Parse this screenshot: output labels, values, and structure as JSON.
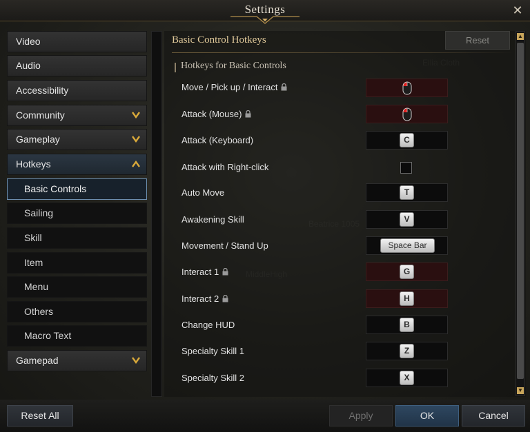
{
  "window": {
    "title": "Settings"
  },
  "nav": {
    "items": [
      {
        "label": "Video"
      },
      {
        "label": "Audio"
      },
      {
        "label": "Accessibility"
      },
      {
        "label": "Community"
      },
      {
        "label": "Gameplay"
      },
      {
        "label": "Hotkeys"
      },
      {
        "label": "Basic Controls"
      },
      {
        "label": "Sailing"
      },
      {
        "label": "Skill"
      },
      {
        "label": "Item"
      },
      {
        "label": "Menu"
      },
      {
        "label": "Others"
      },
      {
        "label": "Macro Text"
      },
      {
        "label": "Gamepad"
      }
    ]
  },
  "panel": {
    "heading": "Basic Control Hotkeys",
    "reset_label": "Reset",
    "subheading": "Hotkeys for Basic Controls",
    "rows": [
      {
        "label": "Move / Pick up / Interact",
        "locked": true,
        "binding": "mouse-left-icon"
      },
      {
        "label": "Attack (Mouse)",
        "locked": true,
        "binding": "mouse-left-icon"
      },
      {
        "label": "Attack (Keyboard)",
        "locked": false,
        "key": "C"
      },
      {
        "label": "Attack with Right-click",
        "locked": false,
        "checked": false
      },
      {
        "label": "Auto Move",
        "locked": false,
        "key": "T"
      },
      {
        "label": "Awakening Skill",
        "locked": false,
        "key": "V"
      },
      {
        "label": "Movement / Stand Up",
        "locked": false,
        "key": "Space Bar"
      },
      {
        "label": "Interact 1",
        "locked": true,
        "key": "G"
      },
      {
        "label": "Interact 2",
        "locked": true,
        "key": "H"
      },
      {
        "label": "Change HUD",
        "locked": false,
        "key": "B"
      },
      {
        "label": "Specialty Skill 1",
        "locked": false,
        "key": "Z"
      },
      {
        "label": "Specialty Skill 2",
        "locked": false,
        "key": "X"
      }
    ]
  },
  "footer": {
    "reset_all": "Reset All",
    "apply": "Apply",
    "ok": "OK",
    "cancel": "Cancel"
  },
  "colors": {
    "accent_gold": "#c8a55b",
    "heading_gold": "#e0c99a",
    "locked_slot": "#2a0f10",
    "active_border": "#6d8fb0"
  }
}
